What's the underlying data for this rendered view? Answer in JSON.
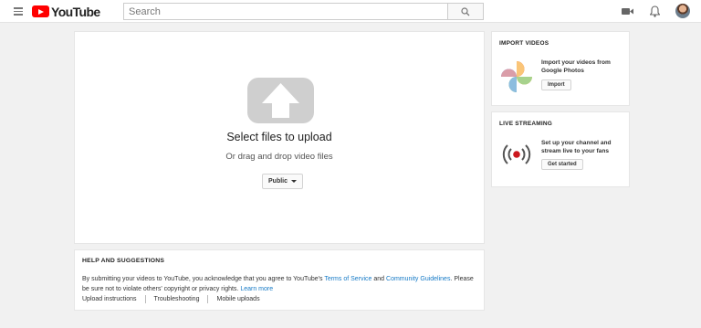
{
  "header": {
    "logo_text": "YouTube",
    "search": {
      "placeholder": "Search",
      "value": ""
    }
  },
  "upload": {
    "title": "Select files to upload",
    "subtitle": "Or drag and drop video files",
    "privacy": "Public"
  },
  "help": {
    "title": "HELP AND SUGGESTIONS",
    "text_part1": "By submitting your videos to YouTube, you acknowledge that you agree to YouTube's ",
    "tos_link": "Terms of Service",
    "text_and": " and ",
    "guidelines_link": "Community Guidelines",
    "text_part2": ". Please be sure not to violate others' copyright or privacy rights. ",
    "learn_more": "Learn more",
    "links": [
      "Upload instructions",
      "Troubleshooting",
      "Mobile uploads"
    ]
  },
  "import": {
    "title": "IMPORT VIDEOS",
    "desc": "Import your videos from Google Photos",
    "button": "Import"
  },
  "live": {
    "title": "LIVE STREAMING",
    "desc": "Set up your channel and stream live to your fans",
    "button": "Get started"
  },
  "icons": {
    "menu": "hamburger-menu-icon",
    "search": "search-icon",
    "video": "video-camera-icon",
    "bell": "bell-icon",
    "upload": "upload-arrow-icon",
    "photos": "google-photos-icon",
    "live": "live-broadcast-icon"
  },
  "colors": {
    "brand_red": "#ff0000",
    "link_blue": "#167ac6",
    "upload_grey": "#cfcfcf",
    "live_red": "#cc181e"
  }
}
